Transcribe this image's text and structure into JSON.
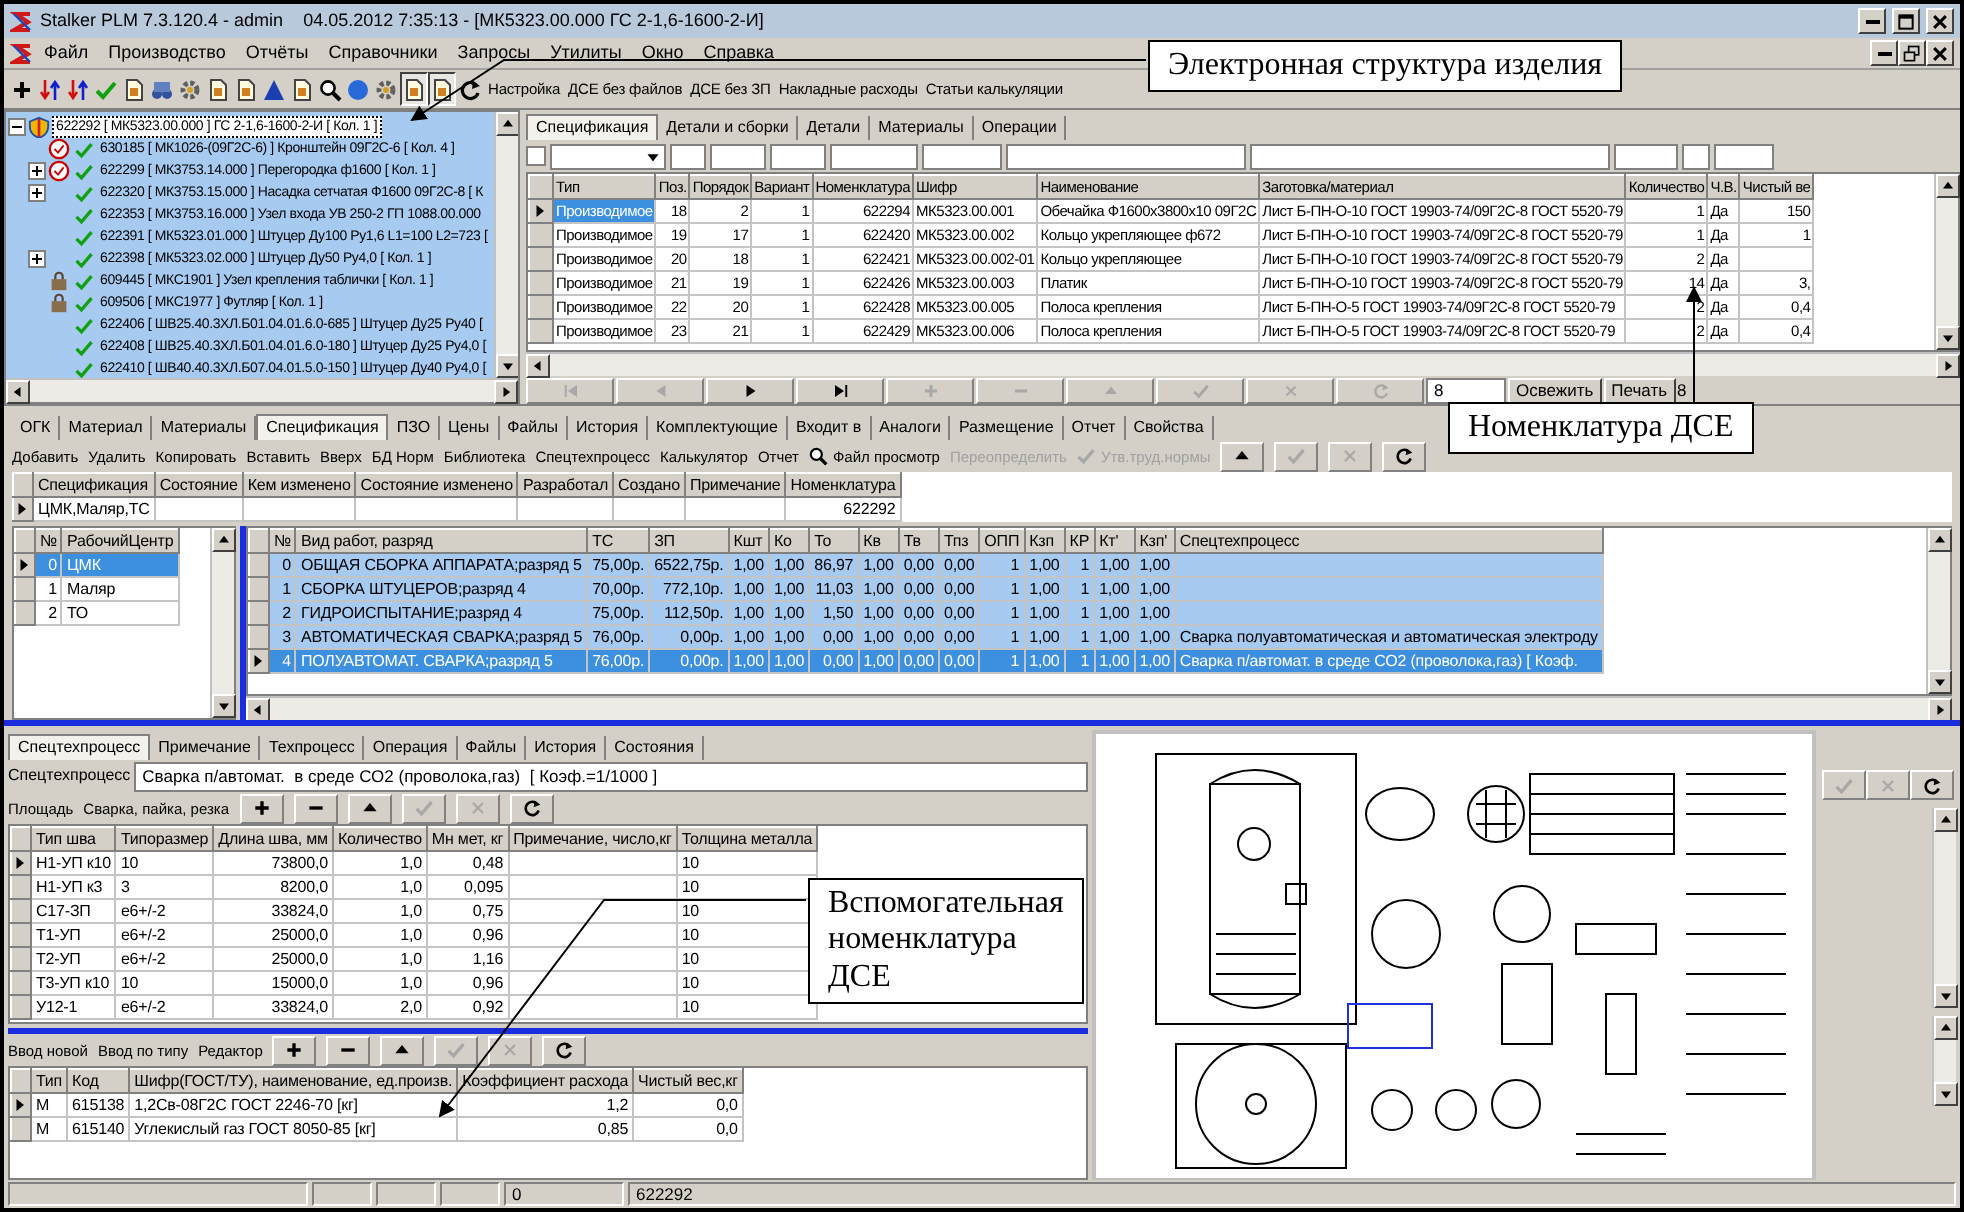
{
  "window": {
    "title": "Stalker PLM 7.3.120.4 - admin    04.05.2012 7:35:13 - [МК5323.00.000 ГС 2-1,6-1600-2-И]"
  },
  "menu": [
    "Файл",
    "Производство",
    "Отчёты",
    "Справочники",
    "Запросы",
    "Утилиты",
    "Окно",
    "Справка"
  ],
  "toolbar": {
    "tools": [
      {
        "kind": "plus",
        "pressed": false
      },
      {
        "kind": "swap",
        "pressed": false
      },
      {
        "kind": "swap",
        "pressed": false
      },
      {
        "kind": "check",
        "pressed": false
      },
      {
        "kind": "doc",
        "pressed": false
      },
      {
        "kind": "binoculars",
        "pressed": false
      },
      {
        "kind": "gear",
        "pressed": false
      },
      {
        "kind": "doc",
        "pressed": false
      },
      {
        "kind": "doc",
        "pressed": false
      },
      {
        "kind": "triangle",
        "pressed": false
      },
      {
        "kind": "doc",
        "pressed": false
      },
      {
        "kind": "search",
        "pressed": false
      },
      {
        "kind": "bubble",
        "pressed": false
      },
      {
        "kind": "gear",
        "pressed": false
      },
      {
        "kind": "doc",
        "pressed": true
      },
      {
        "kind": "doc",
        "pressed": true
      },
      {
        "kind": "refresh",
        "pressed": false
      }
    ],
    "links": [
      "Настройка",
      "ДСЕ без файлов",
      "ДСЕ без ЗП",
      "Накладные расходы",
      "Статьи калькуляции"
    ]
  },
  "tree": {
    "label": "622292 [ МК5323.00.000 ] ГС 2-1,6-1600-2-И [ Кол. 1 ]",
    "expanded": true,
    "selected": true,
    "children": [
      {
        "label": "630185 [ МК1026-(09Г2С-6) ] Кронштейн 09Г2С-6 [ Кол. 4 ]",
        "kind": "stamped",
        "expandable": false,
        "selected": false
      },
      {
        "label": "622299 [ МК3753.14.000 ] Перегородка ф1600 [ Кол. 1 ]",
        "kind": "stamped",
        "expandable": true,
        "selected": false
      },
      {
        "label": "622320 [ МК3753.15.000 ] Насадка сетчатая Ф1600 09Г2С-8 [ К",
        "kind": "plain",
        "expandable": true,
        "selected": false
      },
      {
        "label": "622353 [ МК3753.16.000 ] Узел входа УВ 250-2 ГП 1088.00.000",
        "kind": "plain",
        "expandable": false,
        "selected": false
      },
      {
        "label": "622391 [ МК5323.01.000 ] Штуцер Ду100 Ру1,6 L1=100 L2=723 [",
        "kind": "plain",
        "expandable": false,
        "selected": false
      },
      {
        "label": "622398 [ МК5323.02.000 ] Штуцер Ду50 Ру4,0 [ Кол. 1 ]",
        "kind": "plain",
        "expandable": true,
        "selected": false
      },
      {
        "label": "609445 [ МКС1901 ] Узел крепления таблички [ Кол. 1 ]",
        "kind": "locked",
        "expandable": false,
        "selected": false
      },
      {
        "label": "609506 [ МКС1977 ] Футляр [ Кол. 1 ]",
        "kind": "locked",
        "expandable": false,
        "selected": false
      },
      {
        "label": "622406 [ ШВ25.40.3ХЛ.Б01.04.01.6.0-685 ] Штуцер Ду25 Ру40 [",
        "kind": "plain",
        "expandable": false,
        "selected": false
      },
      {
        "label": "622408 [ ШВ25.40.3ХЛ.Б01.04.01.6.0-180 ] Штуцер Ду25 Ру4,0 [",
        "kind": "plain",
        "expandable": false,
        "selected": false
      },
      {
        "label": "622410 [ ШВ40.40.3ХЛ.Б07.04.01.5.0-150 ] Штуцер Ду40 Ру4,0 [",
        "kind": "plain",
        "expandable": false,
        "selected": false
      }
    ]
  },
  "spec_panel": {
    "tabs": [
      {
        "label": "Спецификация",
        "selected": true
      },
      {
        "label": "Детали и сборки",
        "selected": false
      },
      {
        "label": "Детали",
        "selected": false
      },
      {
        "label": "Материалы",
        "selected": false
      },
      {
        "label": "Операции",
        "selected": false
      }
    ],
    "filter_checkbox": {
      "checked": false
    },
    "table": {
      "columns": [
        "Тип",
        "Поз.",
        "Порядок",
        "Вариант",
        "Номенклатура",
        "Шифр",
        "Наименование",
        "Заготовка/материал",
        "Количество",
        "Ч.В.",
        "Чистый ве"
      ],
      "rows": [
        {
          "cells": [
            "Производимое",
            "18",
            "2",
            "1",
            "622294",
            "МК5323.00.001",
            "Обечайка Ф1600х3800х10 09Г2С",
            "Лист Б-ПН-О-10 ГОСТ 19903-74/09Г2С-8 ГОСТ 5520-79",
            "1",
            "Да",
            "150"
          ],
          "current": true
        },
        {
          "cells": [
            "Производимое",
            "19",
            "17",
            "1",
            "622420",
            "МК5323.00.002",
            "Кольцо укрепляющее ф672",
            "Лист Б-ПН-О-10 ГОСТ 19903-74/09Г2С-8 ГОСТ 5520-79",
            "1",
            "Да",
            "1"
          ],
          "current": false
        },
        {
          "cells": [
            "Производимое",
            "20",
            "18",
            "1",
            "622421",
            "МК5323.00.002-01",
            "Кольцо укрепляющее",
            "Лист Б-ПН-О-10 ГОСТ 19903-74/09Г2С-8 ГОСТ 5520-79",
            "2",
            "Да",
            null
          ],
          "current": false
        },
        {
          "cells": [
            "Производимое",
            "21",
            "19",
            "1",
            "622426",
            "МК5323.00.003",
            "Платик",
            "Лист Б-ПН-О-10 ГОСТ 19903-74/09Г2С-8 ГОСТ 5520-79",
            "14",
            "Да",
            "3,"
          ],
          "current": false
        },
        {
          "cells": [
            "Производимое",
            "22",
            "20",
            "1",
            "622428",
            "МК5323.00.005",
            "Полоса крепления",
            "Лист Б-ПН-О-5 ГОСТ 19903-74/09Г2С-8 ГОСТ 5520-79",
            "2",
            "Да",
            "0,4"
          ],
          "current": false
        },
        {
          "cells": [
            "Производимое",
            "23",
            "21",
            "1",
            "622429",
            "МК5323.00.006",
            "Полоса крепления",
            "Лист Б-ПН-О-5 ГОСТ 19903-74/09Г2С-8 ГОСТ 5520-79",
            "2",
            "Да",
            "0,4"
          ],
          "current": false
        }
      ]
    },
    "navigator": [
      {
        "kind": "first",
        "disabled": true
      },
      {
        "kind": "prev",
        "disabled": true
      },
      {
        "kind": "next",
        "disabled": false
      },
      {
        "kind": "last",
        "disabled": false
      },
      {
        "kind": "plus",
        "disabled": true
      },
      {
        "kind": "minus",
        "disabled": true
      },
      {
        "kind": "up",
        "disabled": true
      },
      {
        "kind": "check",
        "disabled": true
      },
      {
        "kind": "cross",
        "disabled": true
      },
      {
        "kind": "refresh",
        "disabled": true
      }
    ],
    "record_field": "8",
    "refresh_button": "Освежить",
    "print_button": "Печать",
    "record_count": "8"
  },
  "detail_panel": {
    "tabs": [
      {
        "label": "ОГК",
        "selected": false
      },
      {
        "label": "Материал",
        "selected": false
      },
      {
        "label": "Материалы",
        "selected": false
      },
      {
        "label": "Спецификация",
        "selected": true
      },
      {
        "label": "ПЗО",
        "selected": false
      },
      {
        "label": "Цены",
        "selected": false
      },
      {
        "label": "Файлы",
        "selected": false
      },
      {
        "label": "История",
        "selected": false
      },
      {
        "label": "Комплектующие",
        "selected": false
      },
      {
        "label": "Входит в",
        "selected": false
      },
      {
        "label": "Аналоги",
        "selected": false
      },
      {
        "label": "Размещение",
        "selected": false
      },
      {
        "label": "Отчет",
        "selected": false
      },
      {
        "label": "Свойства",
        "selected": false
      }
    ],
    "toolbar": [
      {
        "kind": "text",
        "label": "Добавить",
        "disabled": false
      },
      {
        "kind": "text",
        "label": "Удалить",
        "disabled": false
      },
      {
        "kind": "text",
        "label": "Копировать",
        "disabled": false
      },
      {
        "kind": "text",
        "label": "Вставить",
        "disabled": false
      },
      {
        "kind": "text",
        "label": "Вверх",
        "disabled": false
      },
      {
        "kind": "text",
        "label": "БД Норм",
        "disabled": false
      },
      {
        "kind": "text",
        "label": "Библиотека",
        "disabled": false
      },
      {
        "kind": "text",
        "label": "Спецтехпроцесс",
        "disabled": false
      },
      {
        "kind": "text",
        "label": "Калькулятор",
        "disabled": false
      },
      {
        "kind": "text",
        "label": "Отчет",
        "disabled": false
      },
      {
        "kind": "search",
        "label": "Файл просмотр",
        "disabled": false
      },
      {
        "kind": "text",
        "label": "Переопределить",
        "disabled": true
      },
      {
        "kind": "check",
        "label": "Утв.труд.нормы",
        "disabled": true
      },
      {
        "kind": "up",
        "disabled": false
      },
      {
        "kind": "check",
        "disabled": true
      },
      {
        "kind": "cross",
        "disabled": true
      },
      {
        "kind": "refresh",
        "disabled": false
      }
    ],
    "spec_table": {
      "columns": [
        "Спецификация",
        "Состояние",
        "Кем изменено",
        "Состояние изменено",
        "Разработал",
        "Создано",
        "Примечание",
        "Номенклатура"
      ],
      "rows": [
        {
          "cells": [
            "ЦМК,Маляр,ТС",
            null,
            null,
            null,
            null,
            null,
            null,
            "622292"
          ],
          "current": true
        }
      ]
    },
    "work_centers": {
      "columns": [
        "№",
        "РабочийЦентр"
      ],
      "rows": [
        {
          "cells": [
            "0",
            "ЦМК"
          ],
          "selected": true
        },
        {
          "cells": [
            "1",
            "Маляр"
          ],
          "selected": false
        },
        {
          "cells": [
            "2",
            "ТО"
          ],
          "selected": false
        }
      ]
    },
    "operations": {
      "columns": [
        "№",
        "Вид работ, разряд",
        "ТС",
        "ЗП",
        "Кшт",
        "Ко",
        "То",
        "Кв",
        "Тв",
        "Тпз",
        "ОПП",
        "Кзп",
        "КР",
        "Кт'",
        "Кзп'",
        "Спецтехпроцесс"
      ],
      "rows": [
        {
          "cells": [
            "0",
            "ОБЩАЯ СБОРКА АППАРАТА;разряд 5",
            "75,00р.",
            "6522,75р.",
            "1,00",
            "1,00",
            "86,97",
            "1,00",
            "0,00",
            "0,00",
            "1",
            "1,00",
            "1",
            "1,00",
            "1,00",
            null
          ],
          "selected": true,
          "current": false
        },
        {
          "cells": [
            "1",
            "СБОРКА ШТУЦЕРОВ;разряд 4",
            "70,00р.",
            "772,10р.",
            "1,00",
            "1,00",
            "11,03",
            "1,00",
            "0,00",
            "0,00",
            "1",
            "1,00",
            "1",
            "1,00",
            "1,00",
            null
          ],
          "selected": true,
          "current": false
        },
        {
          "cells": [
            "2",
            "ГИДРОИСПЫТАНИЕ;разряд 4",
            "75,00р.",
            "112,50р.",
            "1,00",
            "1,00",
            "1,50",
            "1,00",
            "0,00",
            "0,00",
            "1",
            "1,00",
            "1",
            "1,00",
            "1,00",
            null
          ],
          "selected": true,
          "current": false
        },
        {
          "cells": [
            "3",
            "АВТОМАТИЧЕСКАЯ СВАРКА;разряд 5",
            "76,00р.",
            "0,00р.",
            "1,00",
            "1,00",
            "0,00",
            "1,00",
            "0,00",
            "0,00",
            "1",
            "1,00",
            "1",
            "1,00",
            "1,00",
            "Сварка полуавтоматическая и автоматическая электроду"
          ],
          "selected": true,
          "current": false
        },
        {
          "cells": [
            "4",
            "ПОЛУАВТОМАТ.   СВАРКА;разряд 5",
            "76,00р.",
            "0,00р.",
            "1,00",
            "1,00",
            "0,00",
            "1,00",
            "0,00",
            "0,00",
            "1",
            "1,00",
            "1",
            "1,00",
            "1,00",
            "Сварка п/автомат.  в среде СО2 (проволока,газ)  [ Коэф."
          ],
          "selected": true,
          "current": true
        }
      ]
    }
  },
  "process_panel": {
    "tabs": [
      {
        "label": "Спецтехпроцесс",
        "selected": true
      },
      {
        "label": "Примечание",
        "selected": false
      },
      {
        "label": "Техпроцесс",
        "selected": false
      },
      {
        "label": "Операция",
        "selected": false
      },
      {
        "label": "Файлы",
        "selected": false
      },
      {
        "label": "История",
        "selected": false
      },
      {
        "label": "Состояния",
        "selected": false
      }
    ],
    "field_label": "Спецтехпроцесс",
    "field_value": "Сварка п/автомат.  в среде СО2 (проволока,газ)  [ Коэф.=1/1000 ]",
    "toolbar": [
      {
        "kind": "text",
        "label": "Площадь",
        "disabled": false
      },
      {
        "kind": "text",
        "label": "Сварка, пайка, резка",
        "disabled": false
      },
      {
        "kind": "plus",
        "disabled": false
      },
      {
        "kind": "minus",
        "disabled": false
      },
      {
        "kind": "up",
        "disabled": false
      },
      {
        "kind": "check",
        "disabled": true
      },
      {
        "kind": "cross",
        "disabled": true
      },
      {
        "kind": "refresh",
        "disabled": false
      }
    ],
    "seams": {
      "columns": [
        "Тип шва",
        "Типоразмер",
        "Длина шва, мм",
        "Количество",
        "Мн мет, кг",
        "Примечание, число,кг",
        "Толщина металла"
      ],
      "rows": [
        {
          "cells": [
            "Н1-УП к10",
            "10",
            "73800,0",
            "1,0",
            "0,48",
            null,
            "10"
          ],
          "current": true
        },
        {
          "cells": [
            "Н1-УП к3",
            "3",
            "8200,0",
            "1,0",
            "0,095",
            null,
            "10"
          ],
          "current": false
        },
        {
          "cells": [
            "С17-ЗП",
            "е6+/-2",
            "33824,0",
            "1,0",
            "0,75",
            null,
            "10"
          ],
          "current": false
        },
        {
          "cells": [
            "Т1-УП",
            "е6+/-2",
            "25000,0",
            "1,0",
            "0,96",
            null,
            "10"
          ],
          "current": false
        },
        {
          "cells": [
            "Т2-УП",
            "е6+/-2",
            "25000,0",
            "1,0",
            "1,16",
            null,
            "10"
          ],
          "current": false
        },
        {
          "cells": [
            "Т3-УП к10",
            "10",
            "15000,0",
            "1,0",
            "0,96",
            null,
            "10"
          ],
          "current": false
        },
        {
          "cells": [
            "У12-1",
            "е6+/-2",
            "33824,0",
            "2,0",
            "0,92",
            null,
            "10"
          ],
          "current": false
        }
      ]
    },
    "aux_toolbar": [
      {
        "kind": "text",
        "label": "Ввод новой",
        "disabled": false
      },
      {
        "kind": "text",
        "label": "Ввод по типу",
        "disabled": false
      },
      {
        "kind": "text",
        "label": "Редактор",
        "disabled": false
      },
      {
        "kind": "plus",
        "disabled": false
      },
      {
        "kind": "minus",
        "disabled": false
      },
      {
        "kind": "up",
        "disabled": false
      },
      {
        "kind": "check",
        "disabled": true
      },
      {
        "kind": "cross",
        "disabled": true
      },
      {
        "kind": "refresh",
        "disabled": false
      }
    ],
    "aux_items": {
      "columns": [
        "Тип",
        "Код",
        "Шифр(ГОСТ/ТУ), наименование, ед.произв.",
        "Коэффициент расхода",
        "Чистый вес,кг"
      ],
      "rows": [
        {
          "cells": [
            "М",
            "615138",
            "1,2Св-08Г2С ГОСТ 2246-70  [кг]",
            "1,2",
            "0,0"
          ],
          "current": true
        },
        {
          "cells": [
            "М",
            "615140",
            "Углекислый газ  ГОСТ 8050-85  [кг]",
            "0,85",
            "0,0"
          ],
          "current": false
        }
      ]
    },
    "side_tools": [
      {
        "kind": "check",
        "disabled": true
      },
      {
        "kind": "cross",
        "disabled": true
      },
      {
        "kind": "refresh",
        "disabled": false
      }
    ]
  },
  "status_bar": [
    "0",
    "622292"
  ],
  "callouts": [
    "Электронная структура изделия",
    "Номенклатура ДСЕ",
    "Вспомогательная номенклатура ДСЕ"
  ]
}
